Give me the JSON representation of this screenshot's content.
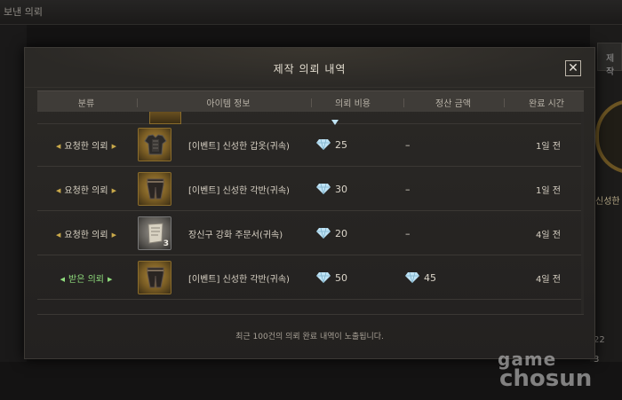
{
  "background": {
    "window_title": "보낸 의뢰",
    "right_tab_label": "제작",
    "right_side_text": "신성한",
    "right_stats": [
      "22",
      "3"
    ]
  },
  "modal": {
    "title": "제작 의뢰 내역",
    "close_icon": "close-icon",
    "columns": [
      "분류",
      "아이템 정보",
      "의뢰 비용",
      "정산 금액",
      "완료 시간"
    ],
    "rows": [
      {
        "category": "요청한 의뢰",
        "category_type": "requested",
        "item_icon": "armor-top-icon",
        "item_qty": "",
        "item_name": "[이벤트] 신성한 갑옷(귀속)",
        "fee": "25",
        "settlement": "–",
        "time": "1일 전"
      },
      {
        "category": "요청한 의뢰",
        "category_type": "requested",
        "item_icon": "greaves-icon",
        "item_qty": "",
        "item_name": "[이벤트] 신성한 각반(귀속)",
        "fee": "30",
        "settlement": "–",
        "time": "1일 전"
      },
      {
        "category": "요청한 의뢰",
        "category_type": "requested",
        "item_icon": "scroll-icon",
        "item_qty": "3",
        "item_name": "장신구 강화 주문서(귀속)",
        "fee": "20",
        "settlement": "–",
        "time": "4일 전"
      },
      {
        "category": "받은 의뢰",
        "category_type": "received",
        "item_icon": "greaves-icon",
        "item_qty": "",
        "item_name": "[이벤트] 신성한 각반(귀속)",
        "fee": "50",
        "settlement": "45",
        "time": "4일 전"
      }
    ],
    "footer_note": "최근 100건의 의뢰 완료 내역이 노출됩니다."
  },
  "watermark": {
    "line1": "game",
    "line2": "chosun"
  },
  "colors": {
    "accent_gold": "#c9a94a",
    "received_green": "#8fdc7d",
    "gem_blue": "#bfe3f5"
  }
}
